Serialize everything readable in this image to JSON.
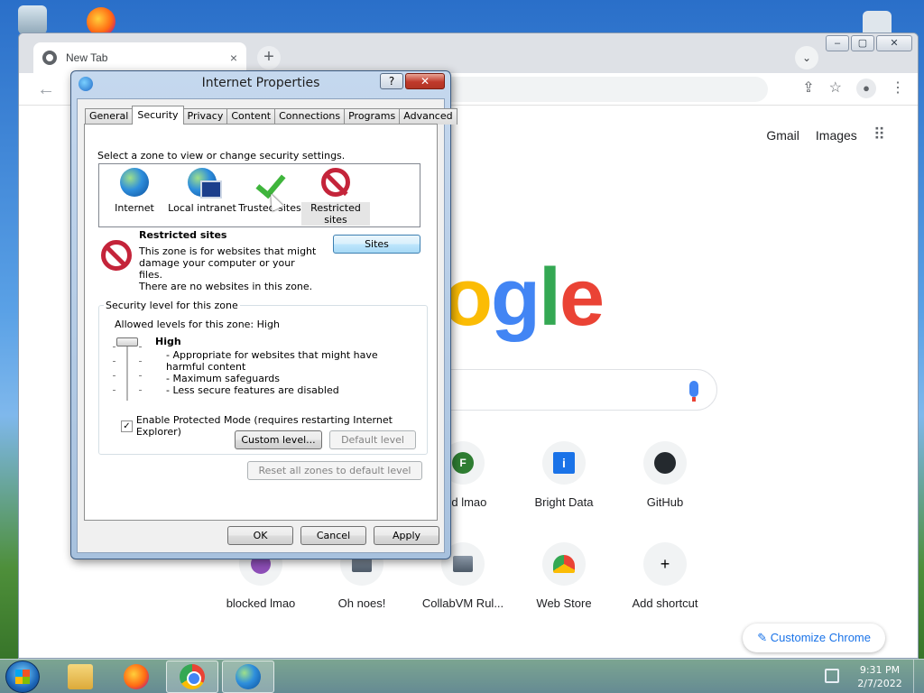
{
  "chrome": {
    "tab_title": "New Tab",
    "tab_close": "×",
    "new_tab": "+",
    "tab_search": "⌄",
    "window_controls": {
      "minimize": "–",
      "maximize": "▢",
      "close": "✕"
    },
    "back": "←",
    "toolbar_icons": {
      "share": "⇪",
      "bookmark": "☆",
      "profile": "●",
      "menu": "⋮"
    },
    "links": {
      "gmail": "Gmail",
      "images": "Images",
      "apps": "⠿"
    },
    "logo_letters": [
      "o",
      "g",
      "l",
      "e"
    ],
    "shortcuts_row1": [
      {
        "label": "ked lmao",
        "badge": "F"
      },
      {
        "label": "Bright Data",
        "badge": "i"
      },
      {
        "label": "GitHub",
        "badge": ""
      }
    ],
    "shortcuts_row2": [
      {
        "label": "blocked lmao"
      },
      {
        "label": "Oh noes!"
      },
      {
        "label": "CollabVM Rul..."
      },
      {
        "label": "Web Store"
      },
      {
        "label": "Add shortcut",
        "badge": "+"
      }
    ],
    "customize_label": "Customize Chrome",
    "customize_icon": "✎"
  },
  "dialog": {
    "title": "Internet Properties",
    "help": "?",
    "close": "✕",
    "tabs": [
      "General",
      "Security",
      "Privacy",
      "Content",
      "Connections",
      "Programs",
      "Advanced"
    ],
    "active_tab": "Security",
    "zone_prompt": "Select a zone to view or change security settings.",
    "zones": [
      {
        "label": "Internet",
        "icon": "globe-icon"
      },
      {
        "label": "Local intranet",
        "icon": "intranet-icon"
      },
      {
        "label": "Trusted sites",
        "icon": "checkmark-icon"
      },
      {
        "label": "Restricted sites",
        "icon": "restricted-icon"
      }
    ],
    "selected_zone": "Restricted sites",
    "zone_name": "Restricted sites",
    "zone_desc": "This zone is for websites that might damage your computer or your files.",
    "zone_none": "There are no websites in this zone.",
    "sites_button": "Sites",
    "group_title": "Security level for this zone",
    "allowed_levels": "Allowed levels for this zone: High",
    "level_name": "High",
    "level_desc": [
      "- Appropriate for websites that might have harmful content",
      "- Maximum safeguards",
      "- Less secure features are disabled"
    ],
    "protected_mode_label": "Enable Protected Mode (requires restarting Internet Explorer)",
    "protected_mode_checked": true,
    "custom_level_button": "Custom level...",
    "default_level_button": "Default level",
    "reset_button": "Reset all zones to default level",
    "ok_button": "OK",
    "cancel_button": "Cancel",
    "apply_button": "Apply"
  },
  "taskbar": {
    "time": "9:31 PM",
    "date": "2/7/2022"
  }
}
